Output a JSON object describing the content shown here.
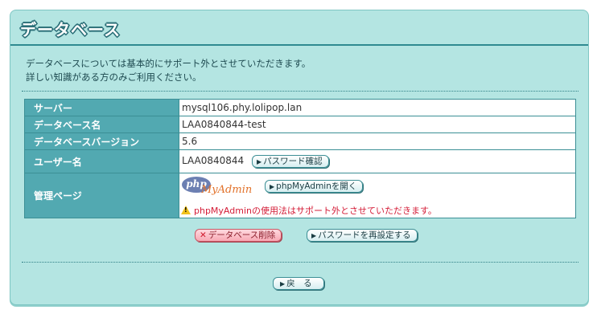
{
  "header": {
    "title": "データベース"
  },
  "description": {
    "line1": "データベースについては基本的にサポート外とさせていただきます。",
    "line2": "詳しい知識がある方のみご利用ください。"
  },
  "table": {
    "server_label": "サーバー",
    "server_value": "mysql106.phy.lolipop.lan",
    "dbname_label": "データベース名",
    "dbname_value": "LAA0840844-test",
    "version_label": "データベースバージョン",
    "version_value": "5.6",
    "user_label": "ユーザー名",
    "user_value": "LAA0840844",
    "password_check_button": "パスワード確認",
    "admin_label": "管理ページ",
    "logo_php": "php",
    "logo_myadmin": "MyAdmin",
    "open_phpmyadmin_button": "phpMyAdminを開く",
    "warning_text": "phpMyAdminの使用法はサポート外とさせていただきます。"
  },
  "actions": {
    "delete_button": "データベース削除",
    "reset_password_button": "パスワードを再設定する",
    "back_button": "戻　る"
  },
  "colors": {
    "panel_bg": "#b4e5e2",
    "table_header_bg": "#52a9b1",
    "warning_text": "#d41c37",
    "delete_button_bg": "#f7a9b4"
  },
  "icons": {
    "button_arrow": "arrow-right-icon",
    "delete_mark": "x-icon",
    "warning": "warning-icon",
    "logo": "phpmyadmin-logo"
  }
}
